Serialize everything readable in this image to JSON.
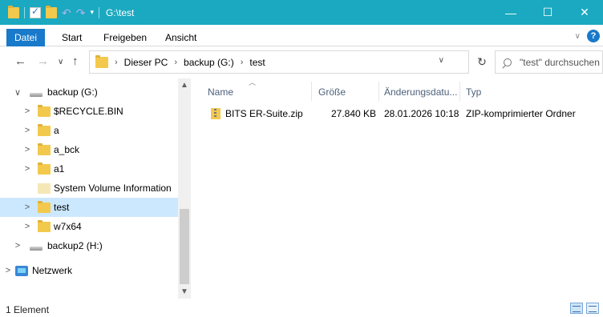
{
  "window": {
    "title": "G:\\test",
    "controls": {
      "minimize": "—",
      "maximize": "☐",
      "close": "✕"
    }
  },
  "ribbon": {
    "tabs": [
      "Datei",
      "Start",
      "Freigeben",
      "Ansicht"
    ],
    "expand_icon": "chevron-down-icon",
    "help_label": "?"
  },
  "address_bar": {
    "breadcrumbs": [
      "Dieser PC",
      "backup (G:)",
      "test"
    ],
    "search_placeholder": "\"test\" durchsuchen"
  },
  "nav_pane": {
    "items": [
      {
        "label": "backup (G:)",
        "expander": "∨",
        "icon": "drive-icon"
      },
      {
        "label": "$RECYCLE.BIN",
        "expander": ">",
        "icon": "folder-icon"
      },
      {
        "label": "a",
        "expander": ">",
        "icon": "folder-icon"
      },
      {
        "label": "a_bck",
        "expander": ">",
        "icon": "folder-icon"
      },
      {
        "label": "a1",
        "expander": ">",
        "icon": "folder-icon"
      },
      {
        "label": "System Volume Information",
        "expander": "",
        "icon": "folder-icon"
      },
      {
        "label": "test",
        "expander": ">",
        "icon": "folder-icon",
        "selected": true
      },
      {
        "label": "w7x64",
        "expander": ">",
        "icon": "folder-icon"
      },
      {
        "label": "backup2 (H:)",
        "expander": ">",
        "icon": "drive-icon"
      },
      {
        "label": "Netzwerk",
        "expander": ">",
        "icon": "network-icon"
      }
    ]
  },
  "file_list": {
    "columns": [
      "Name",
      "Größe",
      "Änderungsdatu...",
      "Typ"
    ],
    "rows": [
      {
        "name": "BITS ER-Suite.zip",
        "size": "27.840 KB",
        "modified": "28.01.2026 10:18",
        "type": "ZIP-komprimierter Ordner",
        "icon": "zip-folder-icon"
      }
    ]
  },
  "status_bar": {
    "count": "1 Element"
  },
  "colors": {
    "titlebar": "#1aa9c0",
    "file_tab": "#1979ca",
    "selection": "#cce8ff"
  }
}
